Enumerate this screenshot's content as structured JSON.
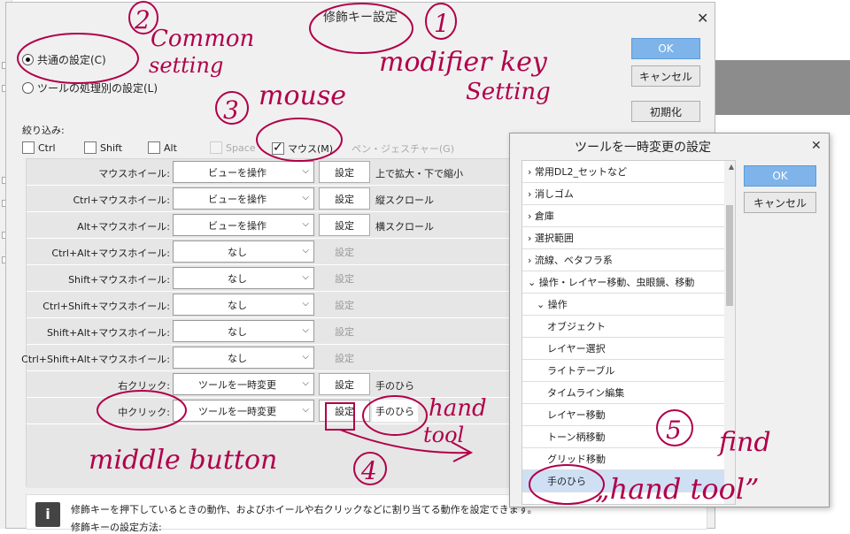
{
  "main_dialog": {
    "title": "修飾キー設定",
    "ok_label": "OK",
    "cancel_label": "キャンセル",
    "reset_label": "初期化",
    "radio_common": "共通の設定(C)",
    "radio_per_tool": "ツールの処理別の設定(L)",
    "filter_label": "絞り込み:",
    "filters": [
      {
        "label": "Ctrl",
        "checked": false,
        "enabled": true
      },
      {
        "label": "Shift",
        "checked": false,
        "enabled": true
      },
      {
        "label": "Alt",
        "checked": false,
        "enabled": true
      },
      {
        "label": "Space",
        "checked": false,
        "enabled": false
      },
      {
        "label": "マウス(M)",
        "checked": true,
        "enabled": true
      },
      {
        "label": "ペン・ジェスチャー(G)",
        "checked": false,
        "enabled": false
      }
    ],
    "rows": [
      {
        "label": "マウスホイール:",
        "action": "ビューを操作",
        "set": "設定",
        "value": "上で拡大・下で縮小"
      },
      {
        "label": "Ctrl+マウスホイール:",
        "action": "ビューを操作",
        "set": "設定",
        "value": "縦スクロール"
      },
      {
        "label": "Alt+マウスホイール:",
        "action": "ビューを操作",
        "set": "設定",
        "value": "横スクロール"
      },
      {
        "label": "Ctrl+Alt+マウスホイール:",
        "action": "なし",
        "set": "設定",
        "value": ""
      },
      {
        "label": "Shift+マウスホイール:",
        "action": "なし",
        "set": "設定",
        "value": ""
      },
      {
        "label": "Ctrl+Shift+マウスホイール:",
        "action": "なし",
        "set": "設定",
        "value": ""
      },
      {
        "label": "Shift+Alt+マウスホイール:",
        "action": "なし",
        "set": "設定",
        "value": ""
      },
      {
        "label": "Ctrl+Shift+Alt+マウスホイール:",
        "action": "なし",
        "set": "設定",
        "value": ""
      },
      {
        "label": "右クリック:",
        "action": "ツールを一時変更",
        "set": "設定",
        "value": "手のひら"
      },
      {
        "label": "中クリック:",
        "action": "ツールを一時変更",
        "set": "設定",
        "value": "手のひら"
      }
    ],
    "info_line1": "修飾キーを押下しているときの動作、およびホイールや右クリックなどに割り当てる動作を設定できます。",
    "info_line2": "修飾キーの設定方法:"
  },
  "tool_dialog": {
    "title": "ツールを一時変更の設定",
    "ok_label": "OK",
    "cancel_label": "キャンセル",
    "items": [
      {
        "label": "› 常用DL2_セットなど",
        "level": 0
      },
      {
        "label": "› 消しゴム",
        "level": 0
      },
      {
        "label": "› 倉庫",
        "level": 0
      },
      {
        "label": "› 選択範囲",
        "level": 0
      },
      {
        "label": "› 流線、ベタフラ系",
        "level": 0
      },
      {
        "label": "⌄ 操作・レイヤー移動、虫眼鏡、移動",
        "level": 0
      },
      {
        "label": "⌄ 操作",
        "level": 1
      },
      {
        "label": "オブジェクト",
        "level": 2
      },
      {
        "label": "レイヤー選択",
        "level": 2
      },
      {
        "label": "ライトテーブル",
        "level": 2
      },
      {
        "label": "タイムライン編集",
        "level": 2
      },
      {
        "label": "レイヤー移動",
        "level": 2
      },
      {
        "label": "トーン柄移動",
        "level": 2
      },
      {
        "label": "グリッド移動",
        "level": 2
      },
      {
        "label": "手のひら",
        "level": 2,
        "selected": true
      }
    ]
  },
  "annotations": {
    "n1": "1",
    "n2": "2",
    "n3": "3",
    "n4": "4",
    "n5": "5",
    "common_1": "Common",
    "common_2": "setting",
    "modifier_1": "modifier key",
    "modifier_2": "Setting",
    "mouse": "mouse",
    "middle": "middle button",
    "hand_1": "hand",
    "hand_2": "tool",
    "find_1": "find",
    "find_2": "„hand tool”"
  },
  "colors": {
    "annotation": "#b0004a",
    "ok_button": "#7eb4ea",
    "selected_item": "#cfe0f5"
  }
}
